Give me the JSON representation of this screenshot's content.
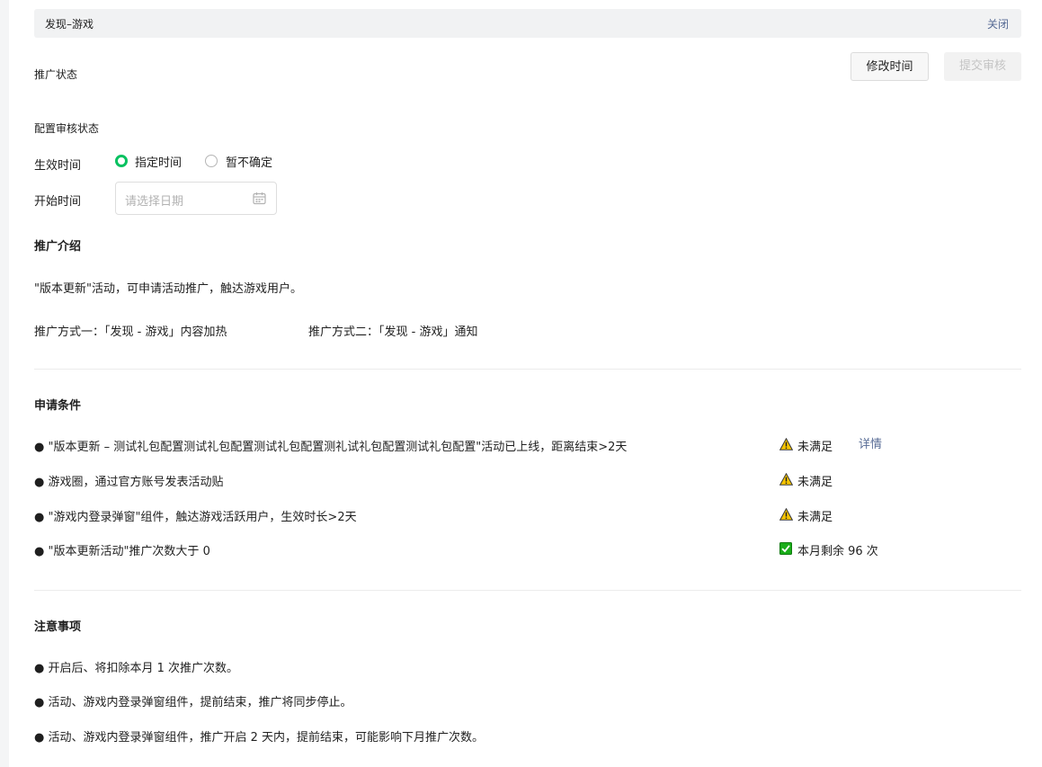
{
  "header": {
    "title": "发现–游戏",
    "close_label": "关闭"
  },
  "status": {
    "promotion_status_label": "推广状态",
    "modify_time_button": "修改时间",
    "submit_review_button": "提交审核",
    "config_review_label": "配置审核状态"
  },
  "form": {
    "effective_time_label": "生效时间",
    "radio_options": [
      {
        "label": "指定时间",
        "selected": true
      },
      {
        "label": "暂不确定",
        "selected": false
      }
    ],
    "start_time_label": "开始时间",
    "date_placeholder": "请选择日期"
  },
  "intro": {
    "heading": "推广介绍",
    "description": "\"版本更新\"活动，可申请活动推广，触达游戏用户。",
    "method_one": "推广方式一：「发现 - 游戏」内容加热",
    "method_two": "推广方式二：「发现 - 游戏」通知"
  },
  "conditions": {
    "heading": "申请条件",
    "items": [
      {
        "text": "● \"版本更新 – 测试礼包配置测试礼包配置测试礼包配置测礼试礼包配置测试礼包配置\"活动已上线，距离结束>2天",
        "status": "未满足",
        "icon": "warning-icon",
        "detail": "详情"
      },
      {
        "text": "● 游戏圈，通过官方账号发表活动贴",
        "status": "未满足",
        "icon": "warning-icon"
      },
      {
        "text": "● \"游戏内登录弹窗\"组件，触达游戏活跃用户，生效时长>2天",
        "status": "未满足",
        "icon": "warning-icon"
      },
      {
        "text": "● \"版本更新活动\"推广次数大于 0",
        "status": "本月剩余 96 次",
        "icon": "check-icon"
      }
    ]
  },
  "notes": {
    "heading": "注意事项",
    "items": [
      "● 开启后、将扣除本月 1 次推广次数。",
      "● 活动、游戏内登录弹窗组件，提前结束，推广将同步停止。",
      "● 活动、游戏内登录弹窗组件，推广开启 2 天内，提前结束，可能影响下月推广次数。"
    ]
  },
  "colors": {
    "accent_green": "#07c160",
    "link_blue": "#576b95",
    "warning_yellow": "#f5c400",
    "check_green": "#1aad19"
  }
}
